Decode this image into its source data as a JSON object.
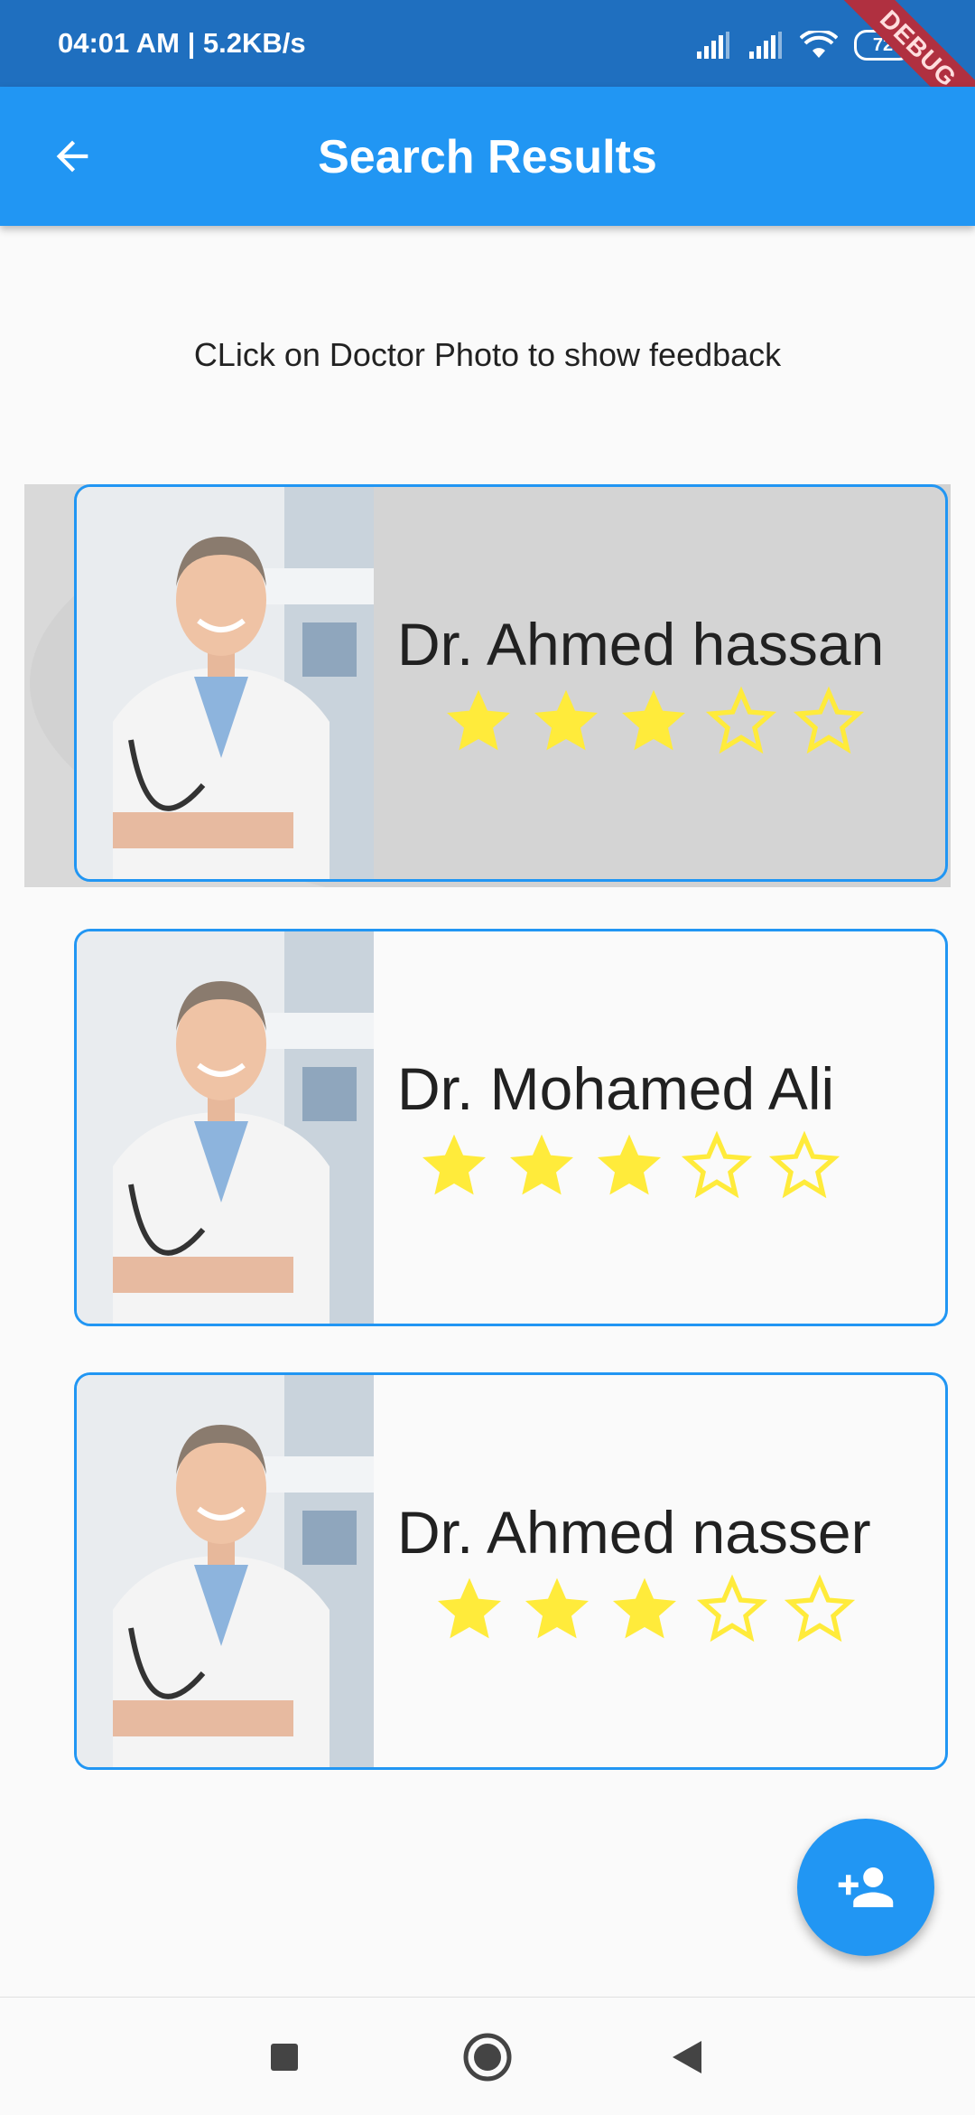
{
  "status_bar": {
    "time_speed": "04:01 AM | 5.2KB/s",
    "battery": "72",
    "debug_label": "DEBUG"
  },
  "app_bar": {
    "title": "Search Results",
    "back_icon": "arrow-back-icon"
  },
  "hint": "CLick on Doctor Photo to show feedback",
  "doctors": [
    {
      "name": "Dr. Ahmed hassan",
      "rating": 3,
      "max_rating": 5
    },
    {
      "name": "Dr. Mohamed Ali",
      "rating": 3,
      "max_rating": 5
    },
    {
      "name": "Dr. Ahmed nasser",
      "rating": 3,
      "max_rating": 5
    }
  ],
  "fab": {
    "icon": "add-person-icon"
  },
  "nav": {
    "icons": [
      "recents-square-icon",
      "home-circle-icon",
      "back-triangle-icon"
    ]
  },
  "colors": {
    "primary": "#2196f3",
    "status_bar": "#1f6fbf",
    "star": "#ffeb3b",
    "highlight": "#d4d4d4"
  }
}
